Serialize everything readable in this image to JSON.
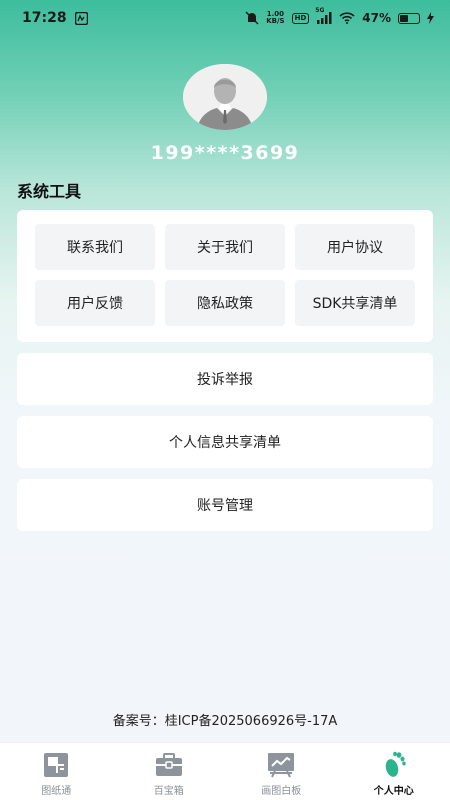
{
  "status_bar": {
    "time": "17:28",
    "net_speed_value": "1.00",
    "net_speed_unit": "KB/S",
    "hd_label": "HD",
    "signal_label": "5G",
    "battery_percent": "47%",
    "battery_level": 0.47
  },
  "profile": {
    "phone": "199****3699"
  },
  "tools": {
    "section_title": "系统工具",
    "items": [
      {
        "label": "联系我们"
      },
      {
        "label": "关于我们"
      },
      {
        "label": "用户协议"
      },
      {
        "label": "用户反馈"
      },
      {
        "label": "隐私政策"
      },
      {
        "label": "SDK共享清单"
      }
    ]
  },
  "rows": [
    {
      "label": "投诉举报"
    },
    {
      "label": "个人信息共享清单"
    },
    {
      "label": "账号管理"
    }
  ],
  "footer": {
    "icp": "备案号：桂ICP备2025066926号-17A"
  },
  "tabbar": {
    "active_color": "#2bb58e",
    "items": [
      {
        "label": "图纸通",
        "icon": "drawing-board-icon"
      },
      {
        "label": "百宝箱",
        "icon": "toolbox-icon"
      },
      {
        "label": "画图白板",
        "icon": "whiteboard-icon"
      },
      {
        "label": "个人中心",
        "icon": "footprint-icon"
      }
    ]
  }
}
